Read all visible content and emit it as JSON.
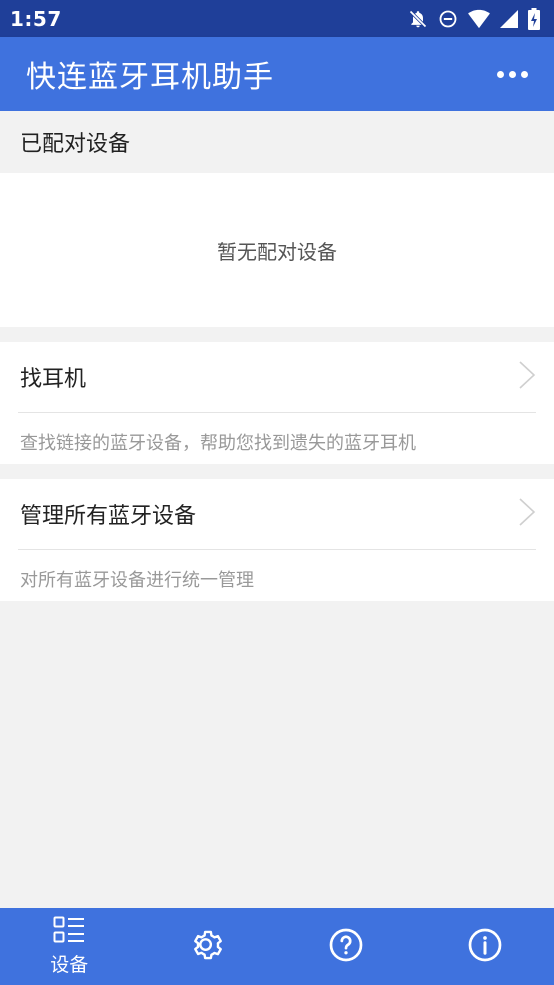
{
  "status_bar": {
    "time": "1:57",
    "icons": [
      "notifications-off-icon",
      "do-not-disturb-icon",
      "wifi-icon",
      "signal-icon",
      "battery-charging-icon"
    ]
  },
  "app_bar": {
    "title": "快连蓝牙耳机助手",
    "menu_icon": "more-horizontal-icon"
  },
  "paired_section": {
    "header": "已配对设备",
    "empty_text": "暂无配对设备"
  },
  "cards": [
    {
      "title": "找耳机",
      "description": "查找链接的蓝牙设备，帮助您找到遗失的蓝牙耳机",
      "icon": "chevron-right-icon"
    },
    {
      "title": "管理所有蓝牙设备",
      "description": "对所有蓝牙设备进行统一管理",
      "icon": "chevron-right-icon"
    }
  ],
  "bottom_nav": {
    "tabs": [
      {
        "label": "设备",
        "icon": "device-list-icon",
        "active": true
      },
      {
        "label": "",
        "icon": "settings-icon"
      },
      {
        "label": "",
        "icon": "help-icon"
      },
      {
        "label": "",
        "icon": "info-icon"
      }
    ]
  },
  "colors": {
    "status_bar": "#1f3f99",
    "primary": "#3f72de",
    "background": "#f2f2f2",
    "card": "#ffffff",
    "description_text": "#999999"
  }
}
